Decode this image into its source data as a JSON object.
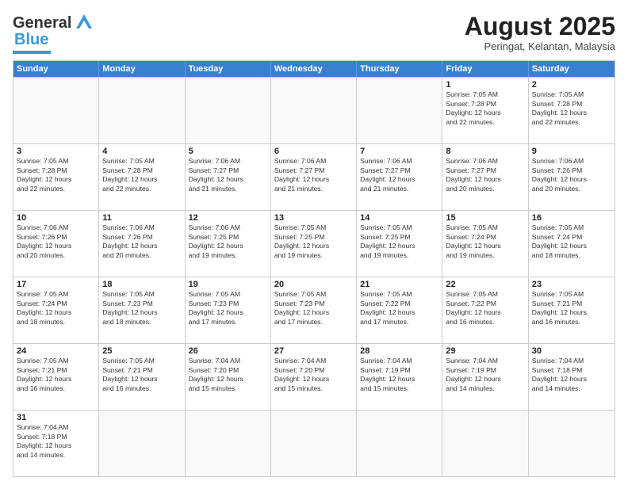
{
  "header": {
    "logo_general": "General",
    "logo_blue": "Blue",
    "month_year": "August 2025",
    "location": "Peringat, Kelantan, Malaysia"
  },
  "days_of_week": [
    "Sunday",
    "Monday",
    "Tuesday",
    "Wednesday",
    "Thursday",
    "Friday",
    "Saturday"
  ],
  "rows": [
    [
      {
        "day": "",
        "info": ""
      },
      {
        "day": "",
        "info": ""
      },
      {
        "day": "",
        "info": ""
      },
      {
        "day": "",
        "info": ""
      },
      {
        "day": "",
        "info": ""
      },
      {
        "day": "1",
        "info": "Sunrise: 7:05 AM\nSunset: 7:28 PM\nDaylight: 12 hours\nand 22 minutes."
      },
      {
        "day": "2",
        "info": "Sunrise: 7:05 AM\nSunset: 7:28 PM\nDaylight: 12 hours\nand 22 minutes."
      }
    ],
    [
      {
        "day": "3",
        "info": "Sunrise: 7:05 AM\nSunset: 7:28 PM\nDaylight: 12 hours\nand 22 minutes."
      },
      {
        "day": "4",
        "info": "Sunrise: 7:05 AM\nSunset: 7:28 PM\nDaylight: 12 hours\nand 22 minutes."
      },
      {
        "day": "5",
        "info": "Sunrise: 7:06 AM\nSunset: 7:27 PM\nDaylight: 12 hours\nand 21 minutes."
      },
      {
        "day": "6",
        "info": "Sunrise: 7:06 AM\nSunset: 7:27 PM\nDaylight: 12 hours\nand 21 minutes."
      },
      {
        "day": "7",
        "info": "Sunrise: 7:06 AM\nSunset: 7:27 PM\nDaylight: 12 hours\nand 21 minutes."
      },
      {
        "day": "8",
        "info": "Sunrise: 7:06 AM\nSunset: 7:27 PM\nDaylight: 12 hours\nand 20 minutes."
      },
      {
        "day": "9",
        "info": "Sunrise: 7:06 AM\nSunset: 7:26 PM\nDaylight: 12 hours\nand 20 minutes."
      }
    ],
    [
      {
        "day": "10",
        "info": "Sunrise: 7:06 AM\nSunset: 7:26 PM\nDaylight: 12 hours\nand 20 minutes."
      },
      {
        "day": "11",
        "info": "Sunrise: 7:06 AM\nSunset: 7:26 PM\nDaylight: 12 hours\nand 20 minutes."
      },
      {
        "day": "12",
        "info": "Sunrise: 7:06 AM\nSunset: 7:25 PM\nDaylight: 12 hours\nand 19 minutes."
      },
      {
        "day": "13",
        "info": "Sunrise: 7:05 AM\nSunset: 7:25 PM\nDaylight: 12 hours\nand 19 minutes."
      },
      {
        "day": "14",
        "info": "Sunrise: 7:05 AM\nSunset: 7:25 PM\nDaylight: 12 hours\nand 19 minutes."
      },
      {
        "day": "15",
        "info": "Sunrise: 7:05 AM\nSunset: 7:24 PM\nDaylight: 12 hours\nand 19 minutes."
      },
      {
        "day": "16",
        "info": "Sunrise: 7:05 AM\nSunset: 7:24 PM\nDaylight: 12 hours\nand 18 minutes."
      }
    ],
    [
      {
        "day": "17",
        "info": "Sunrise: 7:05 AM\nSunset: 7:24 PM\nDaylight: 12 hours\nand 18 minutes."
      },
      {
        "day": "18",
        "info": "Sunrise: 7:05 AM\nSunset: 7:23 PM\nDaylight: 12 hours\nand 18 minutes."
      },
      {
        "day": "19",
        "info": "Sunrise: 7:05 AM\nSunset: 7:23 PM\nDaylight: 12 hours\nand 17 minutes."
      },
      {
        "day": "20",
        "info": "Sunrise: 7:05 AM\nSunset: 7:23 PM\nDaylight: 12 hours\nand 17 minutes."
      },
      {
        "day": "21",
        "info": "Sunrise: 7:05 AM\nSunset: 7:22 PM\nDaylight: 12 hours\nand 17 minutes."
      },
      {
        "day": "22",
        "info": "Sunrise: 7:05 AM\nSunset: 7:22 PM\nDaylight: 12 hours\nand 16 minutes."
      },
      {
        "day": "23",
        "info": "Sunrise: 7:05 AM\nSunset: 7:21 PM\nDaylight: 12 hours\nand 16 minutes."
      }
    ],
    [
      {
        "day": "24",
        "info": "Sunrise: 7:05 AM\nSunset: 7:21 PM\nDaylight: 12 hours\nand 16 minutes."
      },
      {
        "day": "25",
        "info": "Sunrise: 7:05 AM\nSunset: 7:21 PM\nDaylight: 12 hours\nand 16 minutes."
      },
      {
        "day": "26",
        "info": "Sunrise: 7:04 AM\nSunset: 7:20 PM\nDaylight: 12 hours\nand 15 minutes."
      },
      {
        "day": "27",
        "info": "Sunrise: 7:04 AM\nSunset: 7:20 PM\nDaylight: 12 hours\nand 15 minutes."
      },
      {
        "day": "28",
        "info": "Sunrise: 7:04 AM\nSunset: 7:19 PM\nDaylight: 12 hours\nand 15 minutes."
      },
      {
        "day": "29",
        "info": "Sunrise: 7:04 AM\nSunset: 7:19 PM\nDaylight: 12 hours\nand 14 minutes."
      },
      {
        "day": "30",
        "info": "Sunrise: 7:04 AM\nSunset: 7:18 PM\nDaylight: 12 hours\nand 14 minutes."
      }
    ],
    [
      {
        "day": "31",
        "info": "Sunrise: 7:04 AM\nSunset: 7:18 PM\nDaylight: 12 hours\nand 14 minutes."
      },
      {
        "day": "",
        "info": ""
      },
      {
        "day": "",
        "info": ""
      },
      {
        "day": "",
        "info": ""
      },
      {
        "day": "",
        "info": ""
      },
      {
        "day": "",
        "info": ""
      },
      {
        "day": "",
        "info": ""
      }
    ]
  ]
}
